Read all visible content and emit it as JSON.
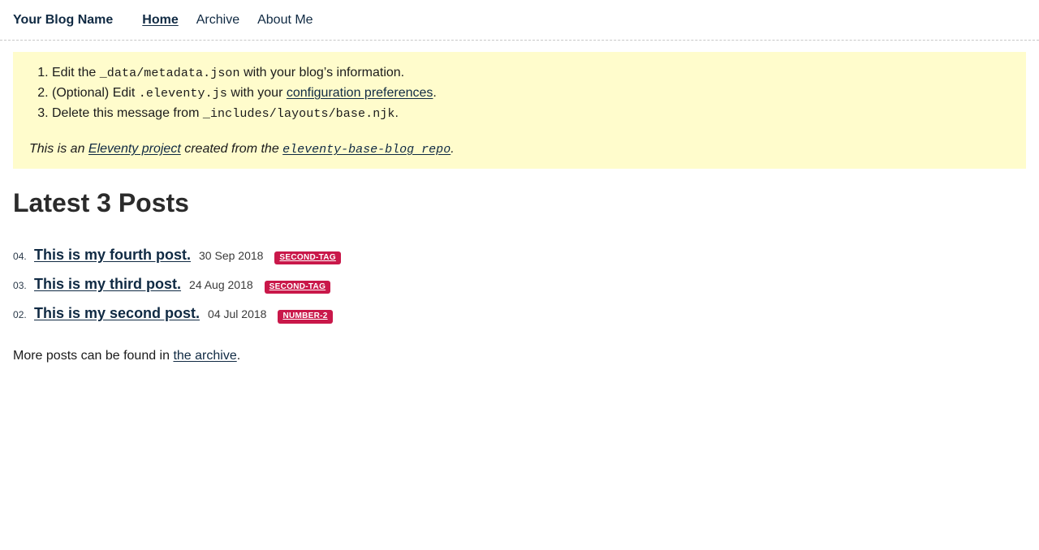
{
  "header": {
    "site_title": "Your Blog Name",
    "nav": [
      {
        "label": "Home",
        "current": true
      },
      {
        "label": "Archive",
        "current": false
      },
      {
        "label": "About Me",
        "current": false
      }
    ]
  },
  "notice": {
    "steps": [
      {
        "before": "Edit the ",
        "code": "_data/metadata.json",
        "after": " with your blog’s information."
      },
      {
        "before": "(Optional) Edit ",
        "code": ".eleventy.js",
        "mid": " with your ",
        "link": "configuration preferences",
        "after": "."
      },
      {
        "before": "Delete this message from ",
        "code": "_includes/layouts/base.njk",
        "after": "."
      }
    ],
    "footer": {
      "lead": "This is an ",
      "link1": "Eleventy project",
      "mid": " created from the ",
      "link2": "eleventy-base-blog repo",
      "end": "."
    }
  },
  "main": {
    "section_title": "Latest 3 Posts",
    "posts": [
      {
        "number": "04.",
        "title": "This is my fourth post.",
        "date": "30 Sep 2018",
        "tag": "SECOND-TAG"
      },
      {
        "number": "03.",
        "title": "This is my third post.",
        "date": "24 Aug 2018",
        "tag": "SECOND-TAG"
      },
      {
        "number": "02.",
        "title": "This is my second post.",
        "date": "04 Jul 2018",
        "tag": "NUMBER-2"
      }
    ],
    "more_posts": {
      "before": "More posts can be found in ",
      "link": "the archive",
      "after": "."
    }
  },
  "colors": {
    "notice_background": "#fffccc",
    "tag_background": "#c9184a",
    "link": "#102a43",
    "heading": "#2b2b2b"
  }
}
